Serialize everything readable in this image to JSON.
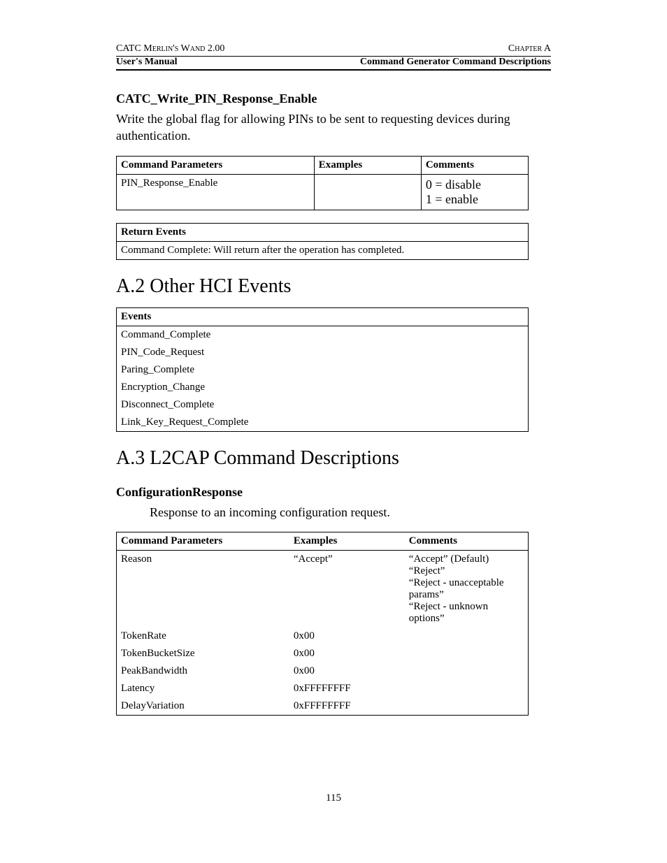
{
  "header": {
    "left_top": "CATC Merlin's Wand 2.00",
    "right_top": "Chapter A",
    "left_bottom": "User's Manual",
    "right_bottom": "Command Generator Command Descriptions"
  },
  "section1": {
    "title": "CATC_Write_PIN_Response_Enable",
    "desc": "Write the global flag for allowing PINs to be sent to requesting devices during authentication.",
    "params_headers": [
      "Command Parameters",
      "Examples",
      "Comments"
    ],
    "rows": [
      {
        "p": "PIN_Response_Enable",
        "e": "",
        "c": "0 = disable\n1 = enable"
      }
    ],
    "return_header": "Return Events",
    "return_text": "Command Complete: Will return after the operation has completed."
  },
  "section2": {
    "title": "A.2  Other HCI Events",
    "events_header": "Events",
    "events": [
      "Command_Complete",
      "PIN_Code_Request",
      "Paring_Complete",
      "Encryption_Change",
      "Disconnect_Complete",
      "Link_Key_Request_Complete"
    ]
  },
  "section3": {
    "title": "A.3  L2CAP Command Descriptions",
    "sub_title": "ConfigurationResponse",
    "desc": "Response to an incoming configuration request.",
    "params_headers": [
      "Command Parameters",
      "Examples",
      "Comments"
    ],
    "rows": [
      {
        "p": "Reason",
        "e": "“Accept”",
        "c": "“Accept” (Default)\n“Reject”\n“Reject - unacceptable params”\n“Reject - unknown options”"
      },
      {
        "p": "TokenRate",
        "e": "0x00",
        "c": ""
      },
      {
        "p": "TokenBucketSize",
        "e": "0x00",
        "c": ""
      },
      {
        "p": "PeakBandwidth",
        "e": "0x00",
        "c": ""
      },
      {
        "p": "Latency",
        "e": "0xFFFFFFFF",
        "c": ""
      },
      {
        "p": "DelayVariation",
        "e": "0xFFFFFFFF",
        "c": ""
      }
    ]
  },
  "page_number": "115"
}
